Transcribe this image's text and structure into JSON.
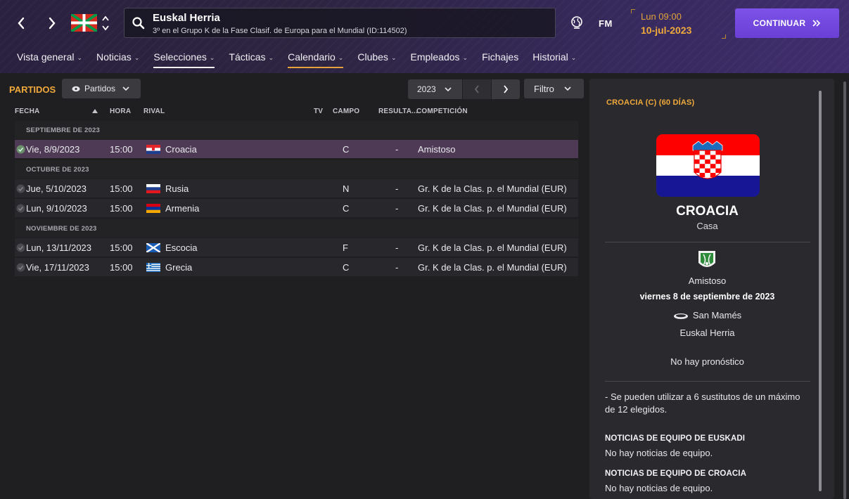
{
  "header": {
    "team_name": "Euskal Herria",
    "team_status": "3º en el Grupo K de la Fase Clasif. de Europa para el Mundial (ID:114502)",
    "logo": "FM",
    "day_time": "Lun 09:00",
    "date": "10-jul-2023",
    "continue_label": "CONTINUAR",
    "icons": [
      "back-arrow",
      "forward-arrow",
      "ikurrina-flag",
      "up-down-chevrons",
      "search",
      "globe",
      "double-chevron-right"
    ]
  },
  "menu": [
    {
      "label": "Vista general",
      "dropdown": true
    },
    {
      "label": "Noticias",
      "dropdown": true
    },
    {
      "label": "Selecciones",
      "dropdown": true,
      "active": "white"
    },
    {
      "label": "Tácticas",
      "dropdown": true
    },
    {
      "label": "Calendario",
      "dropdown": true,
      "active": "orange"
    },
    {
      "label": "Clubes",
      "dropdown": true
    },
    {
      "label": "Empleados",
      "dropdown": true
    },
    {
      "label": "Fichajes",
      "dropdown": false
    },
    {
      "label": "Historial",
      "dropdown": true
    }
  ],
  "matches_panel": {
    "title": "PARTIDOS",
    "view_dropdown": "Partidos",
    "year": "2023",
    "filter_label": "Filtro",
    "columns": {
      "date": "FECHA",
      "time": "HORA",
      "rival": "RIVAL",
      "tv": "TV",
      "venue": "CAMPO",
      "result": "RESULTA...",
      "competition": "COMPETICIÓN"
    },
    "groups": [
      {
        "label": "SEPTIEMBRE DE 2023"
      },
      {
        "label": "OCTUBRE DE 2023"
      },
      {
        "label": "NOVIEMBRE DE 2023"
      }
    ],
    "rows": [
      {
        "date": "Vie, 8/9/2023",
        "time": "15:00",
        "rival": "Croacia",
        "flag": "croatia",
        "venue": "C",
        "result": "-",
        "competition": "Amistoso",
        "selected": true
      },
      {
        "date": "Jue, 5/10/2023",
        "time": "15:00",
        "rival": "Rusia",
        "flag": "russia",
        "venue": "N",
        "result": "-",
        "competition": "Gr. K de la Clas. p. el Mundial (EUR)"
      },
      {
        "date": "Lun, 9/10/2023",
        "time": "15:00",
        "rival": "Armenia",
        "flag": "armenia",
        "venue": "C",
        "result": "-",
        "competition": "Gr. K de la Clas. p. el Mundial (EUR)"
      },
      {
        "date": "Lun, 13/11/2023",
        "time": "15:00",
        "rival": "Escocia",
        "flag": "scotland",
        "venue": "F",
        "result": "-",
        "competition": "Gr. K de la Clas. p. el Mundial (EUR)"
      },
      {
        "date": "Vie, 17/11/2023",
        "time": "15:00",
        "rival": "Grecia",
        "flag": "greece",
        "venue": "C",
        "result": "-",
        "competition": "Gr. K de la Clas. p. el Mundial (EUR)"
      }
    ]
  },
  "detail_panel": {
    "title": "CROACIA (C) (60 DÍAS)",
    "team_name": "CROACIA",
    "venue_type": "Casa",
    "competition": "Amistoso",
    "match_date": "viernes 8 de septiembre de 2023",
    "stadium": "San Mamés",
    "host_team": "Euskal Herria",
    "forecast": "No hay pronóstico",
    "rules": "- Se pueden utilizar a 6 sustitutos de un máximo de 12 elegidos.",
    "news_1_title": "NOTICIAS DE EQUIPO DE EUSKADI",
    "news_1_text": "No hay noticias de equipo.",
    "news_2_title": "NOTICIAS DE EQUIPO DE CROACIA",
    "news_2_text": "No hay noticias de equipo."
  },
  "colors": {
    "accent_orange": "#f0a93a",
    "continue_purple": "#7048e0",
    "selected_row": "#4e3a55"
  }
}
